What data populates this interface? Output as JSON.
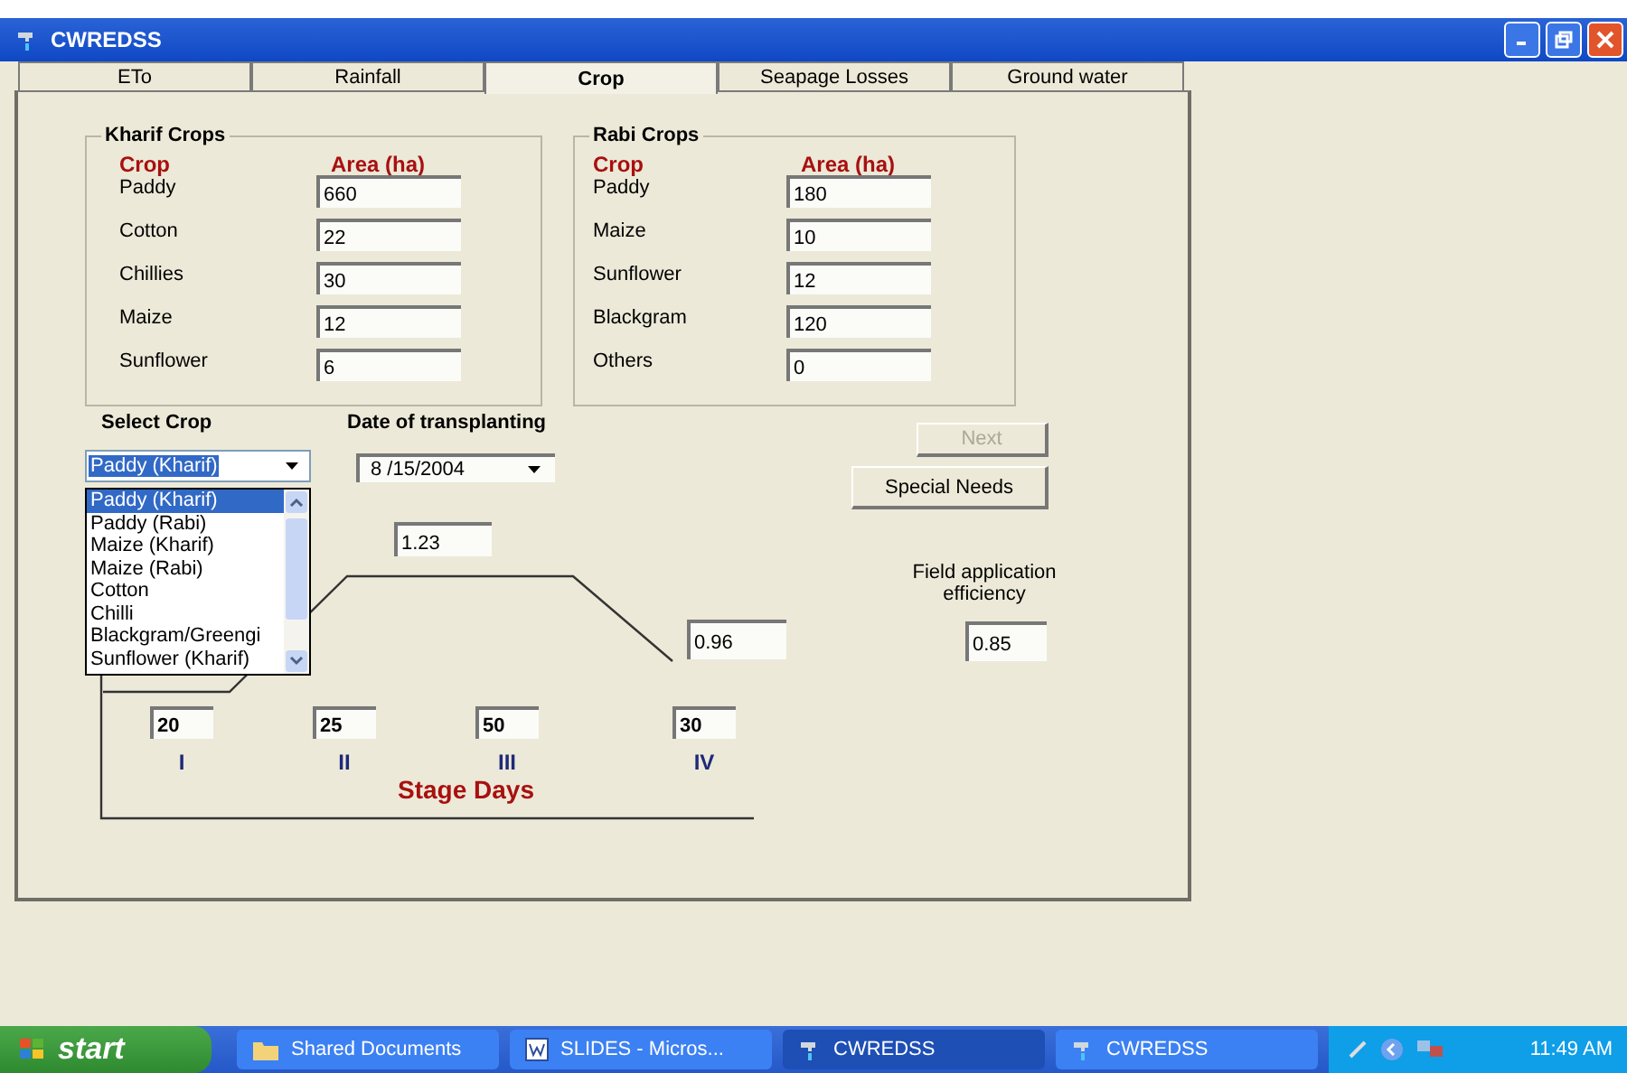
{
  "window": {
    "title": "CWREDSS"
  },
  "tabs": [
    {
      "label": "ETo",
      "selected": false
    },
    {
      "label": "Rainfall",
      "selected": false
    },
    {
      "label": "Crop",
      "selected": true
    },
    {
      "label": "Seapage Losses",
      "selected": false
    },
    {
      "label": "Ground water",
      "selected": false
    }
  ],
  "kharif": {
    "title": "Kharif Crops",
    "crop_header": "Crop",
    "area_header": "Area (ha)",
    "rows": [
      {
        "crop": "Paddy",
        "area": "660"
      },
      {
        "crop": "Cotton",
        "area": "22"
      },
      {
        "crop": "Chillies",
        "area": "30"
      },
      {
        "crop": "Maize",
        "area": "12"
      },
      {
        "crop": "Sunflower",
        "area": "6"
      }
    ]
  },
  "rabi": {
    "title": "Rabi Crops",
    "crop_header": "Crop",
    "area_header": "Area (ha)",
    "rows": [
      {
        "crop": "Paddy",
        "area": "180"
      },
      {
        "crop": "Maize",
        "area": "10"
      },
      {
        "crop": "Sunflower",
        "area": "12"
      },
      {
        "crop": "Blackgram",
        "area": "120"
      },
      {
        "crop": "Others",
        "area": "0"
      }
    ]
  },
  "select_crop": {
    "label": "Select Crop",
    "value": "Paddy (Kharif)",
    "options": [
      {
        "label": "Paddy (Kharif)",
        "selected": true
      },
      {
        "label": "Paddy (Rabi)",
        "selected": false
      },
      {
        "label": "Maize (Kharif)",
        "selected": false
      },
      {
        "label": "Maize (Rabi)",
        "selected": false
      },
      {
        "label": "Cotton",
        "selected": false
      },
      {
        "label": "Chilli",
        "selected": false
      },
      {
        "label": "Blackgram/Greengi",
        "selected": false
      },
      {
        "label": "Sunflower (Kharif)",
        "selected": false
      }
    ]
  },
  "transplanting": {
    "label": "Date of transplanting",
    "value": "8 /15/2004"
  },
  "buttons": [
    {
      "label": "Next",
      "disabled": true
    },
    {
      "label": "Special Needs",
      "disabled": false
    }
  ],
  "crop_curve": {
    "kc_mid": "1.23",
    "kc_end": "0.96",
    "axis_title": "Stage Days",
    "stages": [
      {
        "days": "20",
        "label": "I"
      },
      {
        "days": "25",
        "label": "II"
      },
      {
        "days": "50",
        "label": "III"
      },
      {
        "days": "30",
        "label": "IV"
      }
    ]
  },
  "efficiency": {
    "label": "Field application efficiency",
    "value": "0.85"
  },
  "taskbar": {
    "start": "start",
    "items": [
      {
        "label": "Shared Documents",
        "selected": false,
        "kind": "folder"
      },
      {
        "label": "SLIDES - Micros...",
        "selected": false,
        "kind": "document"
      },
      {
        "label": "CWREDSS",
        "selected": true,
        "kind": "app"
      },
      {
        "label": "CWREDSS",
        "selected": false,
        "kind": "app"
      }
    ],
    "clock": "11:49 AM"
  }
}
